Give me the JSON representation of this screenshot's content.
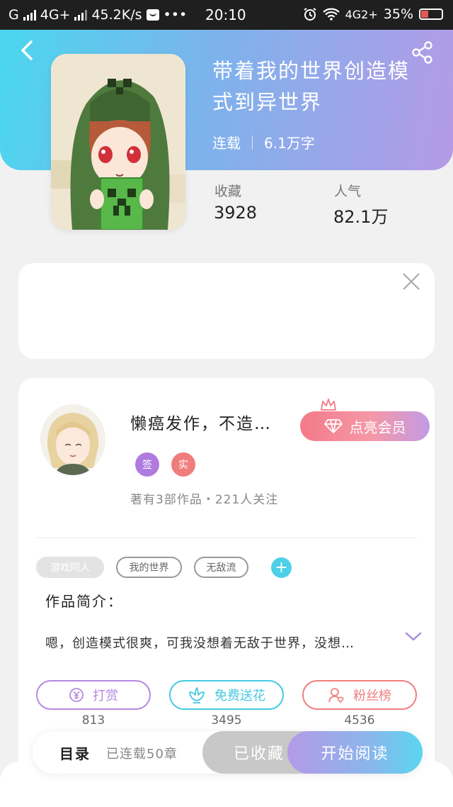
{
  "status_bar": {
    "carrier": "G",
    "network_1": "4G+",
    "speed": "45.2K/s",
    "dots": "•••",
    "time": "20:10",
    "network_2": "4G2+",
    "battery": "35%",
    "battery_level": 0.35
  },
  "book": {
    "title": "带着我的世界创造模式到异世界",
    "status": "连载",
    "word_count": "6.1万字",
    "favorites_label": "收藏",
    "favorites_value": "3928",
    "popularity_label": "人气",
    "popularity_value": "82.1万"
  },
  "author": {
    "name": "懒癌发作，不造…",
    "badge_sign": "签",
    "badge_real": "实",
    "badge_sign_color": "#b07be0",
    "badge_real_color": "#f07d7d",
    "stats": "著有3部作品・221人关注",
    "vip_label": "点亮会员"
  },
  "tags": [
    "游戏同人",
    "我的世界",
    "无敌流"
  ],
  "tag_add": "+",
  "intro": {
    "heading": "作品简介：",
    "text": "嗯，创造模式很爽，可我没想着无敌于世界，没想…"
  },
  "actions": [
    {
      "label": "打赏",
      "count": "813",
      "icon": "coin-icon",
      "color": "#b688e3"
    },
    {
      "label": "免费送花",
      "count": "3495",
      "icon": "flower-icon",
      "color": "#45c9e3"
    },
    {
      "label": "粉丝榜",
      "count": "4536",
      "icon": "fans-icon",
      "color": "#ee7f7f"
    }
  ],
  "bottom": {
    "toc_label": "目录",
    "toc_count": "已连载50章",
    "collected": "已收藏",
    "start_read": "开始阅读"
  },
  "colors": {
    "header_gradient": [
      "#4ad7ee",
      "#b59ae6"
    ],
    "accent_cyan": "#4dd0e8"
  }
}
